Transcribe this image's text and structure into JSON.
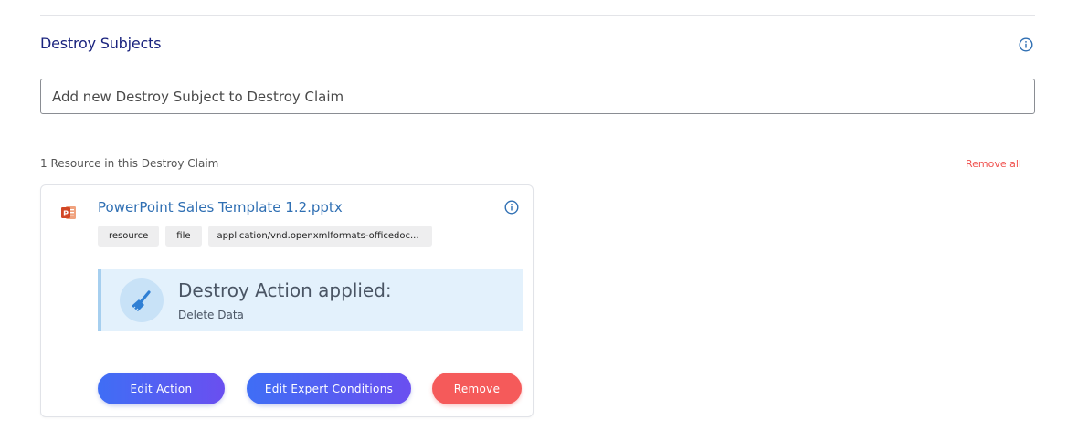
{
  "section": {
    "title": "Destroy Subjects"
  },
  "search": {
    "placeholder": "Add new Destroy Subject to Destroy Claim"
  },
  "resources": {
    "count_label": "1 Resource in this Destroy Claim",
    "remove_all_label": "Remove all"
  },
  "card": {
    "file_name": "PowerPoint Sales Template 1.2.pptx",
    "tags": [
      "resource",
      "file",
      "application/vnd.openxmlformats-officedoc..."
    ],
    "action_title": "Destroy Action applied:",
    "action_value": "Delete Data",
    "buttons": {
      "edit_action": "Edit Action",
      "edit_expert": "Edit Expert Conditions",
      "remove": "Remove"
    }
  },
  "colors": {
    "title": "#1a237e",
    "link": "#2f6fb3",
    "danger": "#f55a5a",
    "primary_gradient_start": "#3f6ef5",
    "primary_gradient_end": "#6a4ff0",
    "action_bg": "#e3f1fc"
  },
  "icons": {
    "section_info": "info-icon",
    "card_info": "info-icon",
    "file_type": "powerpoint-icon",
    "action": "broom-icon"
  }
}
